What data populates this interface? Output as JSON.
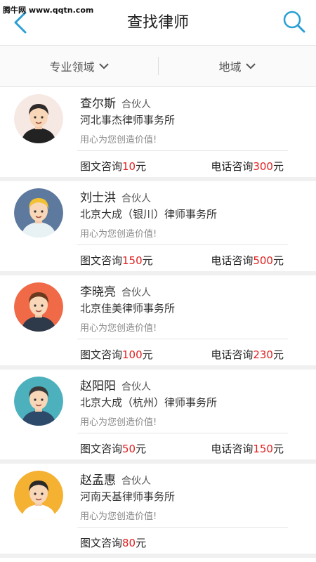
{
  "watermark": "腾牛网 www.qqtn.com",
  "header": {
    "title": "查找律师"
  },
  "filters": [
    {
      "label": "专业领域"
    },
    {
      "label": "地域"
    }
  ],
  "lawyers": [
    {
      "name": "查尔斯",
      "role": "合伙人",
      "firm": "河北事杰律师事务所",
      "slogan": "用心为您创造价值!",
      "text_label": "图文咨询",
      "text_price": "10",
      "phone_label": "电话咨询",
      "phone_price": "300",
      "unit": "元",
      "avatar_bg": "#f6e8e2",
      "avatar_hair": "#2e2a2a",
      "avatar_shirt": "#222222"
    },
    {
      "name": "刘士洪",
      "role": "合伙人",
      "firm": "北京大成（银川）律师事务所",
      "slogan": "用心为您创造价值!",
      "text_label": "图文咨询",
      "text_price": "150",
      "phone_label": "电话咨询",
      "phone_price": "500",
      "unit": "元",
      "avatar_bg": "#5d7a9e",
      "avatar_hair": "#f2c232",
      "avatar_shirt": "#e8f2f4"
    },
    {
      "name": "李晓亮",
      "role": "合伙人",
      "firm": "北京佳美律师事务所",
      "slogan": "用心为您创造价值!",
      "text_label": "图文咨询",
      "text_price": "100",
      "phone_label": "电话咨询",
      "phone_price": "230",
      "unit": "元",
      "avatar_bg": "#f06a48",
      "avatar_hair": "#6a3a1e",
      "avatar_shirt": "#2e3a4a"
    },
    {
      "name": "赵阳阳",
      "role": "合伙人",
      "firm": "北京大成（杭州）律师事务所",
      "slogan": "用心为您创造价值!",
      "text_label": "图文咨询",
      "text_price": "50",
      "phone_label": "电话咨询",
      "phone_price": "150",
      "unit": "元",
      "avatar_bg": "#4cb1bd",
      "avatar_hair": "#3a3a3a",
      "avatar_shirt": "#2e4a6a"
    },
    {
      "name": "赵孟惠",
      "role": "合伙人",
      "firm": "河南天基律师事务所",
      "slogan": "用心为您创造价值!",
      "text_label": "图文咨询",
      "text_price": "80",
      "phone_label": "",
      "phone_price": "",
      "unit": "元",
      "avatar_bg": "#f5b132",
      "avatar_hair": "#2a2a2a",
      "avatar_shirt": "#ffffff"
    }
  ]
}
